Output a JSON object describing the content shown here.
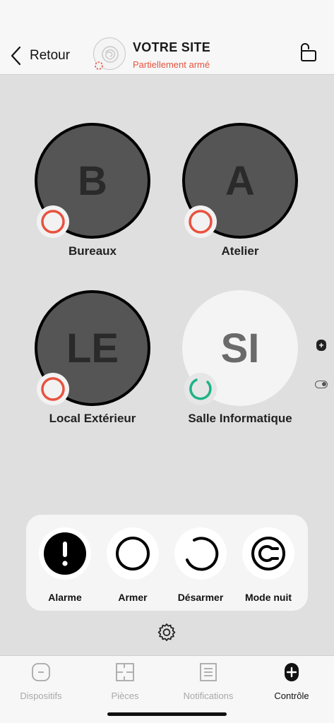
{
  "header": {
    "back_label": "Retour",
    "site_title": "VOTRE SITE",
    "site_status": "Partiellement armé",
    "status_color": "#e8523f"
  },
  "zones": [
    {
      "initials": "B",
      "label": "Bureaux",
      "state": "armed",
      "badge_color": "#e8523f"
    },
    {
      "initials": "A",
      "label": "Atelier",
      "state": "armed",
      "badge_color": "#e8523f"
    },
    {
      "initials": "LE",
      "label": "Local Extérieur",
      "state": "armed",
      "badge_color": "#e8523f"
    },
    {
      "initials": "SI",
      "label": "Salle Informatique",
      "state": "disarmed",
      "badge_color": "#1db386"
    }
  ],
  "actions": [
    {
      "label": "Alarme",
      "icon": "alarm-icon"
    },
    {
      "label": "Armer",
      "icon": "arm-icon"
    },
    {
      "label": "Désarmer",
      "icon": "disarm-icon"
    },
    {
      "label": "Mode nuit",
      "icon": "night-mode-icon"
    }
  ],
  "tabs": [
    {
      "label": "Dispositifs",
      "icon": "devices-icon",
      "active": false
    },
    {
      "label": "Pièces",
      "icon": "rooms-icon",
      "active": false
    },
    {
      "label": "Notifications",
      "icon": "notifications-icon",
      "active": false
    },
    {
      "label": "Contrôle",
      "icon": "control-icon",
      "active": true
    }
  ]
}
